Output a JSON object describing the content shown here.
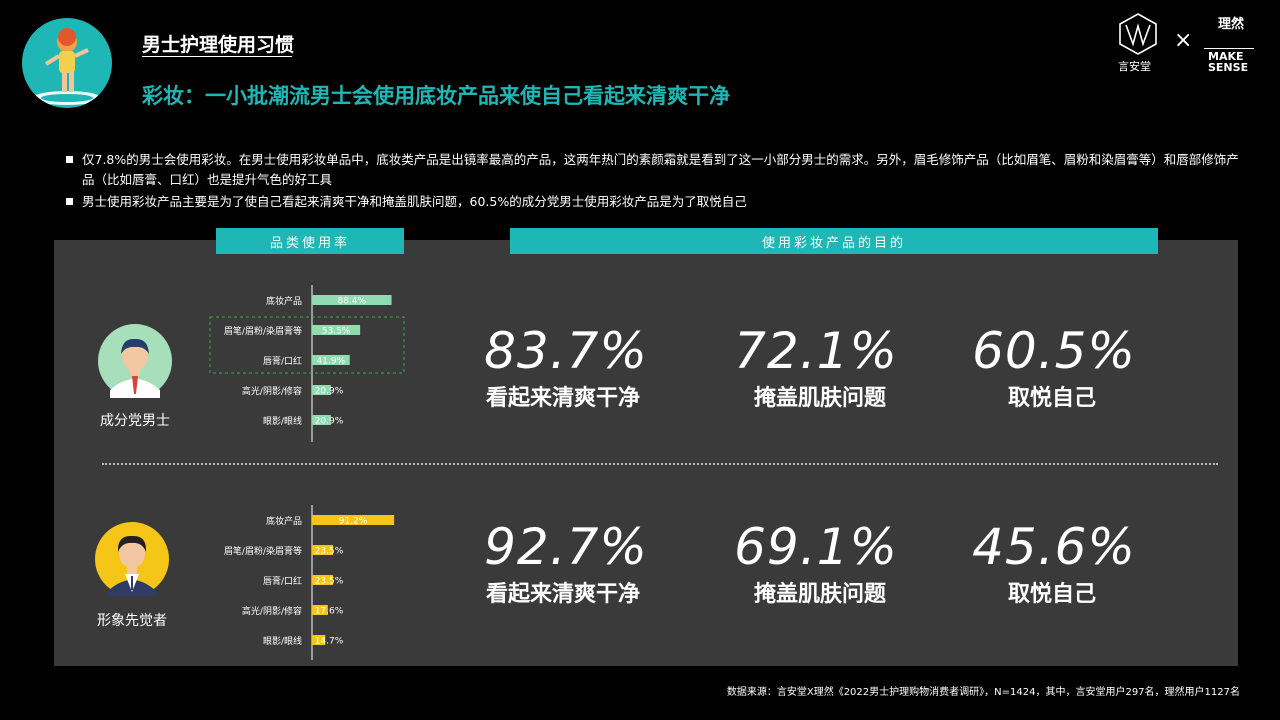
{
  "header": {
    "section_title": "男士护理使用习惯",
    "headline": "彩妆：一小批潮流男士会使用底妆产品来使自己看起来清爽干净"
  },
  "logos": {
    "brand1": "言安堂",
    "separator": "×",
    "brand2_cn": "理然",
    "brand2_en_1": "MAKE",
    "brand2_en_2": "SENSE"
  },
  "bullets": [
    "仅7.8%的男士会使用彩妆。在男士使用彩妆单品中，底妆类产品是出镜率最高的产品，这两年热门的素颜霜就是看到了这一小部分男士的需求。另外，眉毛修饰产品（比如眉笔、眉粉和染眉膏等）和唇部修饰产品（比如唇膏、口红）也是提升气色的好工具",
    "男士使用彩妆产品主要是为了使自己看起来清爽干净和掩盖肌肤问题，60.5%的成分党男士使用彩妆产品是为了取悦自己"
  ],
  "panel_headers": {
    "left": "品类使用率",
    "right": "使用彩妆产品的目的"
  },
  "groups": [
    {
      "name": "成分党男士",
      "purposes": [
        {
          "value": "83.7%",
          "label": "看起来清爽干净"
        },
        {
          "value": "72.1%",
          "label": "掩盖肌肤问题"
        },
        {
          "value": "60.5%",
          "label": "取悦自己"
        }
      ]
    },
    {
      "name": "形象先觉者",
      "purposes": [
        {
          "value": "92.7%",
          "label": "看起来清爽干净"
        },
        {
          "value": "69.1%",
          "label": "掩盖肌肤问题"
        },
        {
          "value": "45.6%",
          "label": "取悦自己"
        }
      ]
    }
  ],
  "chart_data": [
    {
      "type": "bar",
      "orientation": "horizontal",
      "group": "成分党男士",
      "color": "#8fdcb0",
      "categories": [
        "底妆产品",
        "眉笔/眉粉/染眉膏等",
        "唇膏/口红",
        "高光/阴影/修容",
        "眼影/眼线"
      ],
      "values": [
        88.4,
        53.5,
        41.9,
        20.9,
        20.9
      ],
      "value_labels": [
        "88.4%",
        "53.5%",
        "41.9%",
        "20.9%",
        "20.9%"
      ],
      "xlim": [
        0,
        100
      ]
    },
    {
      "type": "bar",
      "orientation": "horizontal",
      "group": "形象先觉者",
      "color": "#f5c518",
      "categories": [
        "底妆产品",
        "眉笔/眉粉/染眉膏等",
        "唇膏/口红",
        "高光/阴影/修容",
        "眼影/眼线"
      ],
      "values": [
        91.2,
        23.5,
        23.5,
        17.6,
        14.7
      ],
      "value_labels": [
        "91.2%",
        "23.5%",
        "23.5%",
        "17.6%",
        "14.7%"
      ],
      "xlim": [
        0,
        100
      ]
    }
  ],
  "footer": "数据来源：言安堂X理然《2022男士护理购物消费者调研》，N=1424，其中，言安堂用户297名，理然用户1127名"
}
